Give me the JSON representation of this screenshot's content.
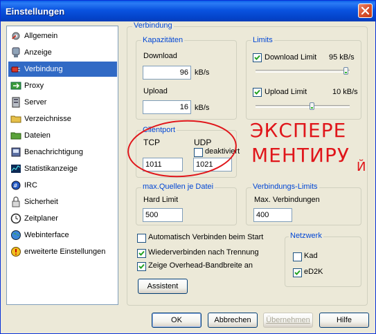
{
  "window": {
    "title": "Einstellungen"
  },
  "nav": {
    "items": [
      {
        "label": "Allgemein",
        "icon": "gear-wrench-icon"
      },
      {
        "label": "Anzeige",
        "icon": "display-icon"
      },
      {
        "label": "Verbindung",
        "icon": "connection-plug-icon"
      },
      {
        "label": "Proxy",
        "icon": "proxy-icon"
      },
      {
        "label": "Server",
        "icon": "server-icon"
      },
      {
        "label": "Verzeichnisse",
        "icon": "folder-icon"
      },
      {
        "label": "Dateien",
        "icon": "files-icon"
      },
      {
        "label": "Benachrichtigung",
        "icon": "notification-icon"
      },
      {
        "label": "Statistikanzeige",
        "icon": "statistics-icon"
      },
      {
        "label": "IRC",
        "icon": "irc-icon"
      },
      {
        "label": "Sicherheit",
        "icon": "lock-icon"
      },
      {
        "label": "Zeitplaner",
        "icon": "clock-icon"
      },
      {
        "label": "Webinterface",
        "icon": "globe-icon"
      },
      {
        "label": "erweiterte Einstellungen",
        "icon": "warning-icon"
      }
    ],
    "selected": "Verbindung"
  },
  "verbindung": {
    "title": "Verbindung",
    "kapazitaeten": {
      "title": "Kapazitäten",
      "download_label": "Download",
      "download_value": "96",
      "download_unit": "kB/s",
      "upload_label": "Upload",
      "upload_value": "16",
      "upload_unit": "kB/s"
    },
    "limits": {
      "title": "Limits",
      "download_limit_label": "Download Limit",
      "download_limit_checked": true,
      "download_limit_value": "95 kB/s",
      "upload_limit_label": "Upload Limit",
      "upload_limit_checked": true,
      "upload_limit_value": "10 kB/s"
    },
    "clientport": {
      "title": "Clientport",
      "tcp_label": "TCP",
      "tcp_value": "1011",
      "udp_label": "UDP",
      "udp_disabled_label": "deaktiviert",
      "udp_disabled_checked": false,
      "udp_value": "1021"
    },
    "max_quellen": {
      "title": "max.Quellen je Datei",
      "hard_limit_label": "Hard Limit",
      "hard_limit_value": "500"
    },
    "verbindungs_limits": {
      "title": "Verbindungs-Limits",
      "max_label": "Max. Verbindungen",
      "max_value": "400"
    },
    "options": {
      "auto_connect_label": "Automatisch Verbinden beim Start",
      "auto_connect_checked": false,
      "reconnect_label": "Wiederverbinden nach Trennung",
      "reconnect_checked": true,
      "overhead_label": "Zeige Overhead-Bandbreite an",
      "overhead_checked": true
    },
    "assistant_label": "Assistent",
    "netzwerk": {
      "title": "Netzwerk",
      "kad_label": "Kad",
      "kad_checked": false,
      "ed2k_label": "eD2K",
      "ed2k_checked": true
    }
  },
  "buttons": {
    "ok": "OK",
    "cancel": "Abbrechen",
    "apply": "Übernehmen",
    "help": "Hilfe"
  },
  "annotation": {
    "line1": "ЭКСПЕРЕ",
    "line2": "МЕНТИРУ",
    "tail": "Й"
  },
  "colors": {
    "title_bar": "#0a53e0",
    "selection": "#316ac5",
    "group_title": "#0046d5",
    "annotation": "#e0161b"
  }
}
